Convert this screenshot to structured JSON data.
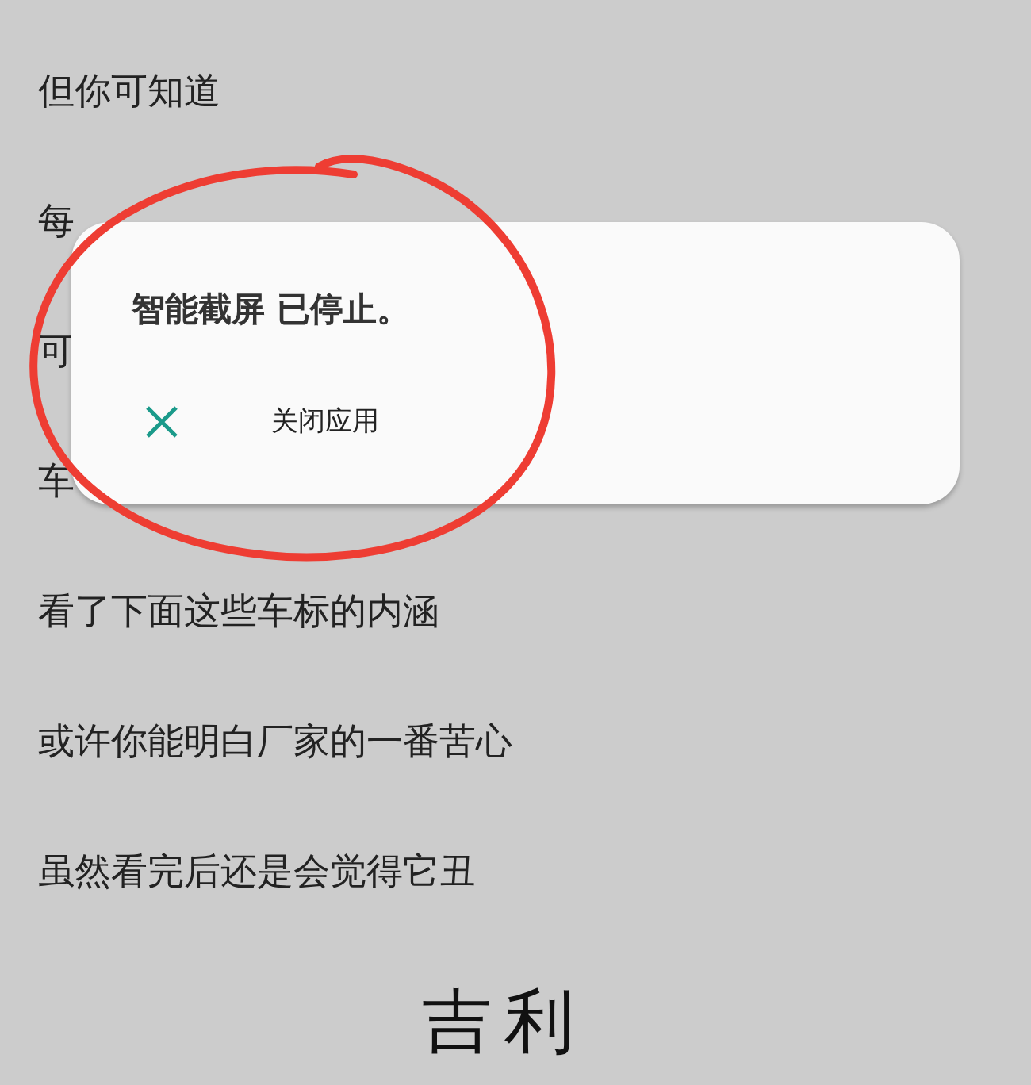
{
  "lines": [
    "但你可知道",
    "每",
    "可",
    "车",
    "看了下面这些车标的内涵",
    "或许你能明白厂家的一番苦心",
    "虽然看完后还是会觉得它丑"
  ],
  "heading": "吉利",
  "dialog": {
    "title": "智能截屏 已停止。",
    "action": "关闭应用"
  }
}
